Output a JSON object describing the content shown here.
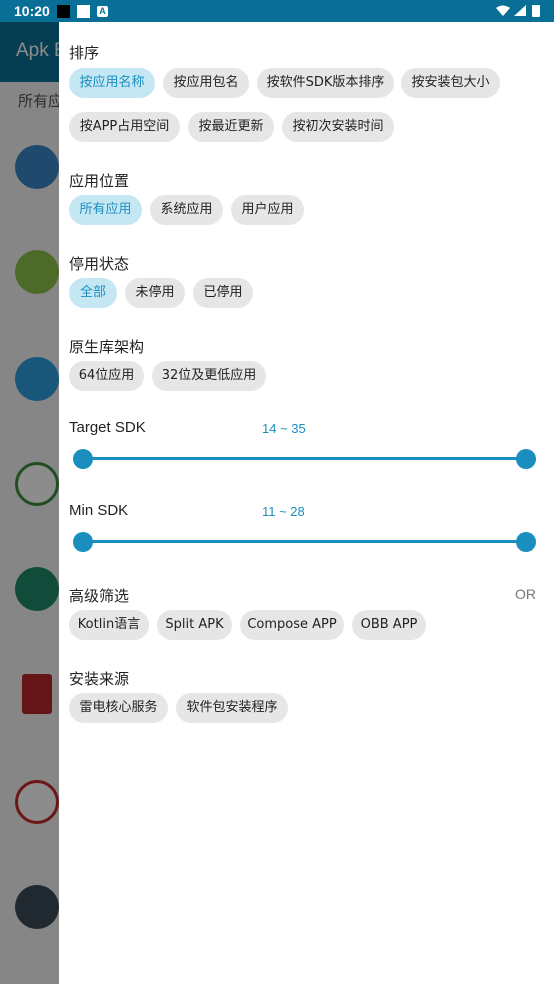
{
  "status_bar": {
    "time": "10:20",
    "a_badge": "A"
  },
  "background_app": {
    "title": "Apk E",
    "filter_text": "所有应"
  },
  "drawer": {
    "sort": {
      "title": "排序",
      "options": [
        "按应用名称",
        "按应用包名",
        "按软件SDK版本排序",
        "按安装包大小",
        "按APP占用空间",
        "按最近更新",
        "按初次安装时间"
      ],
      "selected": "按应用名称"
    },
    "location": {
      "title": "应用位置",
      "options": [
        "所有应用",
        "系统应用",
        "用户应用"
      ],
      "selected": "所有应用"
    },
    "disabled_state": {
      "title": "停用状态",
      "options": [
        "全部",
        "未停用",
        "已停用"
      ],
      "selected": "全部"
    },
    "native_abi": {
      "title": "原生库架构",
      "options": [
        "64位应用",
        "32位及更低应用"
      ]
    },
    "target_sdk": {
      "title": "Target SDK",
      "range_text": "14 ~ 35",
      "min": 14,
      "max": 35
    },
    "min_sdk": {
      "title": "Min SDK",
      "range_text": "11 ~ 28",
      "min": 11,
      "max": 28
    },
    "advanced": {
      "title": "高级筛选",
      "mode": "OR",
      "options": [
        "Kotlin语言",
        "Split APK",
        "Compose APP",
        "OBB APP"
      ]
    },
    "install_source": {
      "title": "安装来源",
      "options": [
        "雷电核心服务",
        "软件包安装程序"
      ]
    }
  },
  "colors": {
    "accent": "#1a8fbf",
    "appbar": "#0a6f96",
    "chip": "#e6e6e6",
    "chip_selected": "#c5e7f4"
  }
}
